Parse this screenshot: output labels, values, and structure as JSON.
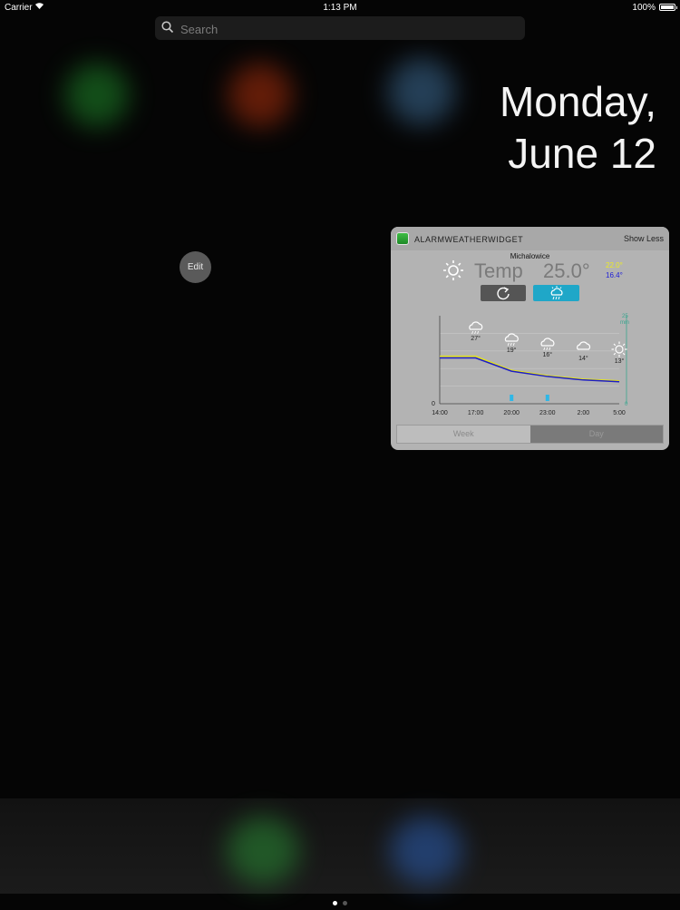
{
  "status_bar": {
    "carrier": "Carrier",
    "time": "1:13 PM",
    "battery": "100%",
    "battery_level": 1.0
  },
  "search": {
    "placeholder": "Search"
  },
  "date": {
    "line1": "Monday,",
    "line2": "June 12"
  },
  "edit_button": "Edit",
  "widget": {
    "app_name": "ALARMWEATHERWIDGET",
    "show_less": "Show Less",
    "city": "Michalowice",
    "temp_label": "Temp",
    "temp_value": "25.0°",
    "temp_max": "22.0°",
    "temp_min": "16.4°",
    "tabs": [
      {
        "label": "Week",
        "selected": false
      },
      {
        "label": "Day",
        "selected": true
      }
    ],
    "colors": {
      "max_line": "#e2e21c",
      "min_line": "#1d1dc7",
      "rain": "#2fb7e6",
      "precip_axis": "#3aa58f"
    }
  },
  "chart_data": {
    "type": "line",
    "x": [
      "14:00",
      "17:00",
      "20:00",
      "23:00",
      "2:00",
      "5:00"
    ],
    "y_axis_left_label": "0",
    "y_axis_right_label_top": "25",
    "y_axis_right_label_unit": "mm",
    "y_axis_right_label_bottom": "0",
    "icon_labels": [
      "27°",
      "19°",
      "16°",
      "14°",
      "13°"
    ],
    "icons": [
      "rain-cloud-icon",
      "rain-cloud-icon",
      "rain-cloud-icon",
      "cloud-sun-icon",
      "sun-icon"
    ],
    "series": [
      {
        "name": "max",
        "values": [
          27,
          27,
          19,
          16,
          14,
          13
        ]
      },
      {
        "name": "min",
        "values": [
          26,
          26,
          18.5,
          15.5,
          13.5,
          12.5
        ]
      }
    ],
    "precipitation": [
      0,
      0,
      1,
      1,
      0,
      0
    ],
    "ylim": [
      0,
      50
    ]
  },
  "page_dots": [
    true,
    false
  ]
}
